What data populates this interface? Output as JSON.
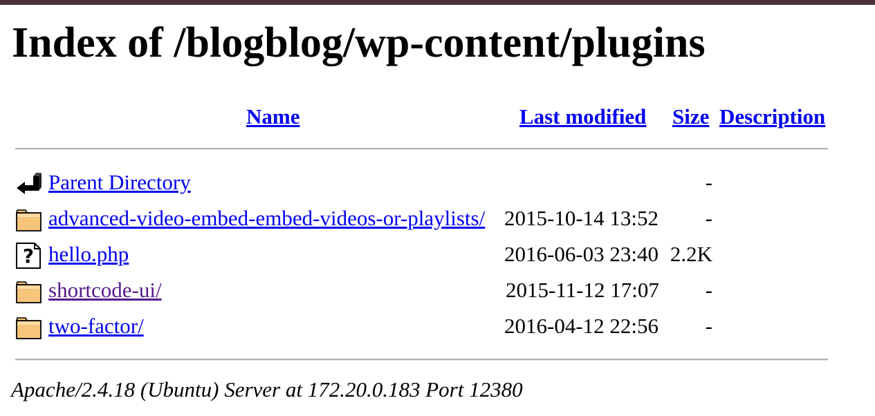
{
  "title": "Index of /blogblog/wp-content/plugins",
  "columns": {
    "name": "Name",
    "last_modified": "Last modified",
    "size": "Size",
    "description": "Description"
  },
  "rows": [
    {
      "icon": "back-icon",
      "name": "Parent Directory",
      "modified": "",
      "size": "-",
      "visited": false
    },
    {
      "icon": "folder-icon",
      "name": "advanced-video-embed-embed-videos-or-playlists/",
      "modified": "2015-10-14 13:52",
      "size": "-",
      "visited": false
    },
    {
      "icon": "unknown-file-icon",
      "name": "hello.php",
      "modified": "2016-06-03 23:40",
      "size": "2.2K",
      "visited": false
    },
    {
      "icon": "folder-icon",
      "name": "shortcode-ui/",
      "modified": "2015-11-12 17:07",
      "size": "-",
      "visited": true
    },
    {
      "icon": "folder-icon",
      "name": "two-factor/",
      "modified": "2016-04-12 22:56",
      "size": "-",
      "visited": false
    }
  ],
  "footer": "Apache/2.4.18 (Ubuntu) Server at 172.20.0.183 Port 12380",
  "colors": {
    "link": "#0000ee",
    "visited_link": "#551a8b",
    "top_bar": "#4a3338",
    "folder": "#f6c47a"
  }
}
